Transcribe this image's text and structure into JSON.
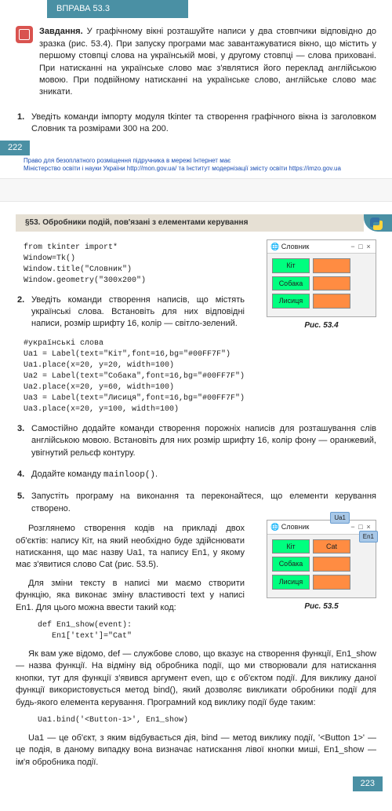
{
  "header": {
    "exercise": "ВПРАВА 53.3"
  },
  "task": {
    "label": "Завдання.",
    "text": " У графічному вікні розташуйте написи у два стовпчики відповідно до зразка (рис. 53.4). При запуску програми має завантажуватися вікно, що містить у першому стовпці слова на українській мові, у другому стовпці — слова приховані. При натисканні на українське слово має з'являтися його переклад англійською мовою. При подвійному натисканні на українське слово, англійське слово має зникати."
  },
  "step1": {
    "num": "1.",
    "text": "Уведіть команди імпорту модуля tkinter та створення графічного вікна із заголовком Словник та розмірами 300 на 200."
  },
  "page_left": "222",
  "footer": {
    "line1": "Право для безоплатного розміщення підручника в мережі Інтернет має",
    "line2": "Міністерство освіти і науки України http://mon.gov.ua/ та Інститут модернізації змісту освіти https://imzo.gov.ua"
  },
  "section_title": "§53. Обробники подій, пов'язані з елементами керування",
  "code1": "from tkinter import*\nWindow=Tk()\nWindow.title(\"Словник\")\nWindow.geometry(\"300x200\")",
  "win1": {
    "title": "Словник",
    "labels": [
      "Кіт",
      "Собака",
      "Лисиця"
    ]
  },
  "fig1": "Рис. 53.4",
  "step2": {
    "num": "2.",
    "text": "Уведіть команди створення написів, що містять українські слова. Встановіть для них відповідні написи, розмір шрифту 16, колір — світло-зелений."
  },
  "code2": "#українські слова\nUa1 = Label(text=\"Кіт\",font=16,bg=\"#00FF7F\")\nUa1.place(x=20, y=20, width=100)\nUa2 = Label(text=\"Собака\",font=16,bg=\"#00FF7F\")\nUa2.place(x=20, y=60, width=100)\nUa3 = Label(text=\"Лисиця\",font=16,bg=\"#00FF7F\")\nUa3.place(x=20, y=100, width=100)",
  "step3": {
    "num": "3.",
    "text": "Самостійно додайте команди створення порожніх написів для розташування слів англійською мовою. Встановіть для них розмір шрифту 16, колір фону — оранжевий, увігнутий рельєф контуру."
  },
  "step4": {
    "num": "4.",
    "text_pre": "Додайте команду ",
    "code": "mainloop()",
    "text_post": "."
  },
  "step5": {
    "num": "5.",
    "text": "Запустіть програму на виконання та переконайтеся, що елементи керування створено."
  },
  "para1": "Розглянемо створення кодів на прикладі двох об'єктів: напису Кіт, на який необхідно буде здійснювати натискання, що має назву Ua1, та напису En1, у якому має з'явитися слово Cat (рис. 53.5).",
  "para2": "Для зміни тексту в написі ми маємо створити функцію, яка виконає зміну властивості text у написі En1. Для цього можна ввести такий код:",
  "win2": {
    "title": "Словник",
    "row1": [
      "Кіт",
      "Cat"
    ],
    "others": [
      "Собака",
      "Лисиця"
    ],
    "callout_ua1": "Ua1",
    "callout_en1": "En1"
  },
  "fig2": "Рис. 53.5",
  "code3": "def En1_show(event):\n   En1['text']=\"Cat\"",
  "para3": "Як вам уже відомо, def — службове слово, що вказує на створення функції, En1_show — назва функції. На відміну від обробника події, що ми створювали для натискання кнопки, тут для функції з'явився аргумент even, що є об'єктом події. Для виклику даної функції використовується метод bind(), який дозволяє викликати обробники події для будь-якого елемента керування. Програмний код виклику події буде таким:",
  "code4": "Ua1.bind('<Button-1>', En1_show)",
  "para4": "Ua1 — це об'єкт, з яким відбувається дія, bind — метод виклику події, '<Button 1>' — це подія, в даному випадку вона визначає натискання лівої кнопки миші, En1_show — ім'я обробника події.",
  "page_right": "223"
}
